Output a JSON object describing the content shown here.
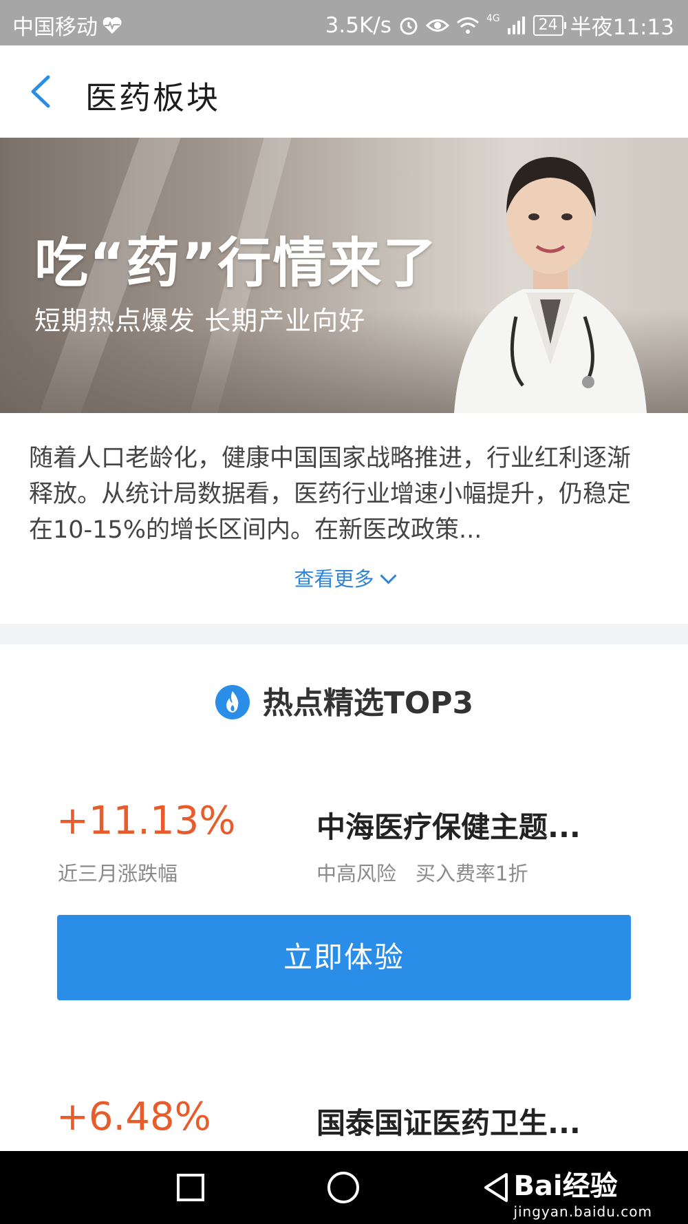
{
  "status_bar": {
    "carrier": "中国移动",
    "speed": "3.5K/s",
    "network": "4G",
    "battery": "24",
    "time": "半夜11:13"
  },
  "header": {
    "title": "医药板块"
  },
  "banner": {
    "title": "吃“药”行情来了",
    "subtitle": "短期热点爆发 长期产业向好"
  },
  "intro": {
    "text": "随着人口老龄化，健康中国国家战略推进，行业红利逐渐释放。从统计局数据看，医药行业增速小幅提升，仍稳定在10-15%的增长区间内。在新医改政策...",
    "more_label": "查看更多"
  },
  "hot_section": {
    "title": "热点精选TOP3"
  },
  "funds": [
    {
      "change": "+11.13%",
      "change_label": "近三月涨跌幅",
      "name": "中海医疗保健主题...",
      "risk": "中高风险",
      "fee": "买入费率1折",
      "button": "立即体验"
    },
    {
      "change": "+6.48%",
      "name": "国泰国证医药卫生..."
    }
  ],
  "watermark": {
    "brand": "Bai经验",
    "url": "jingyan.baidu.com"
  },
  "colors": {
    "accent": "#2a8de8",
    "rise": "#e85c2c",
    "status_bar": "#a6a6a6"
  }
}
